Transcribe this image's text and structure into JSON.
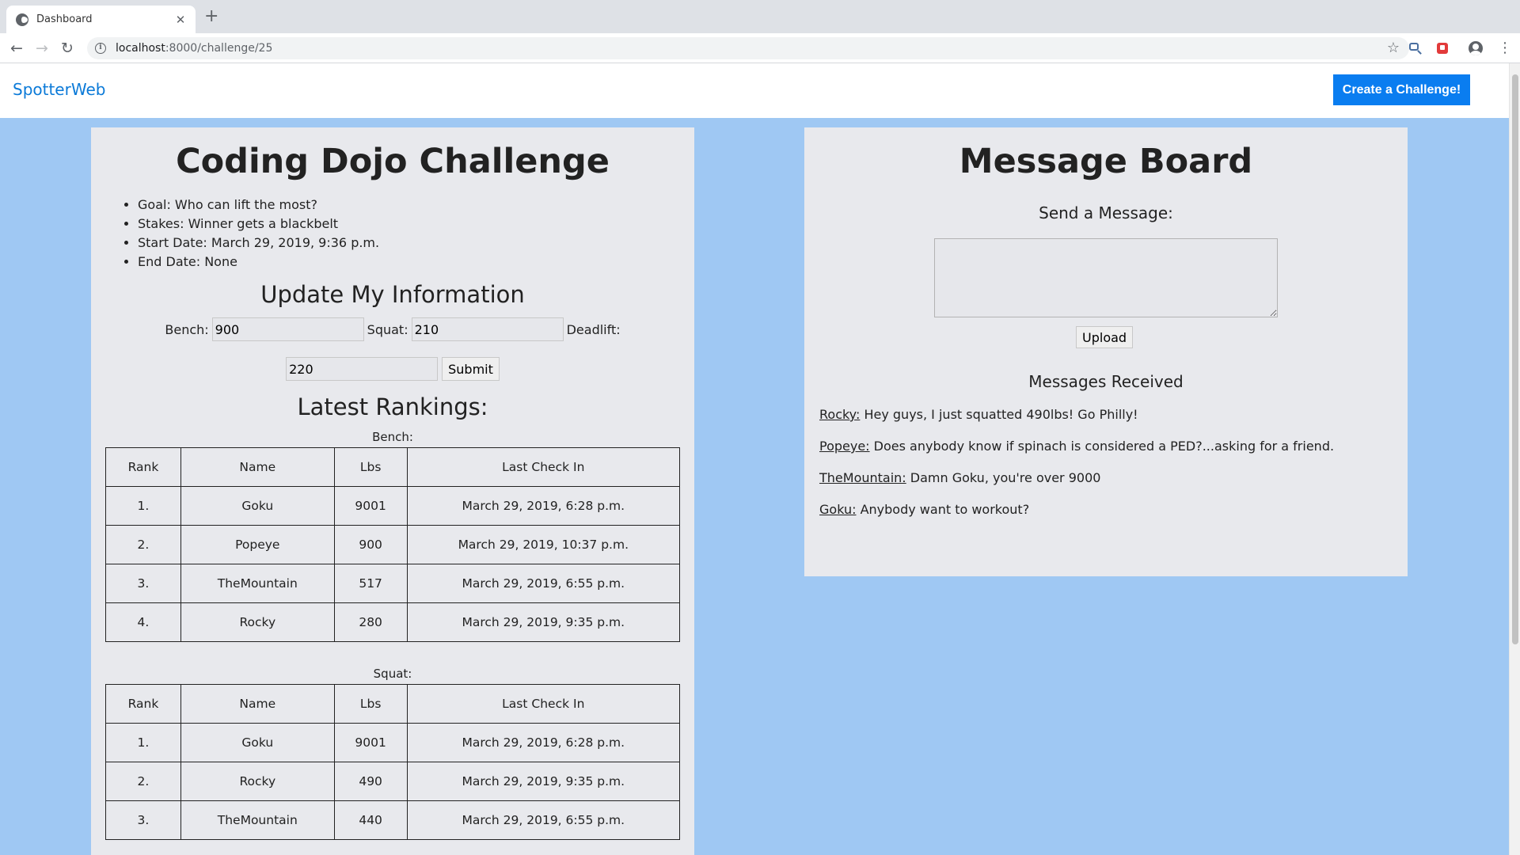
{
  "browser": {
    "tab_title": "Dashboard",
    "url_host": "localhost",
    "url_path": ":8000/challenge/25"
  },
  "nav": {
    "brand": "SpotterWeb",
    "create_button": "Create a Challenge!"
  },
  "challenge": {
    "title": "Coding Dojo Challenge",
    "details": [
      "Goal: Who can lift the most?",
      "Stakes: Winner gets a blackbelt",
      "Start Date: March 29, 2019, 9:36 p.m.",
      "End Date: None"
    ]
  },
  "update_form": {
    "title": "Update My Information",
    "bench_label": "Bench:",
    "bench_value": "900",
    "squat_label": "Squat:",
    "squat_value": "210",
    "deadlift_label": "Deadlift:",
    "deadlift_value": "220",
    "submit_label": "Submit"
  },
  "rankings": {
    "title": "Latest Rankings:",
    "columns": [
      "Rank",
      "Name",
      "Lbs",
      "Last Check In"
    ],
    "bench": {
      "caption": "Bench:",
      "rows": [
        [
          "1.",
          "Goku",
          "9001",
          "March 29, 2019, 6:28 p.m."
        ],
        [
          "2.",
          "Popeye",
          "900",
          "March 29, 2019, 10:37 p.m."
        ],
        [
          "3.",
          "TheMountain",
          "517",
          "March 29, 2019, 6:55 p.m."
        ],
        [
          "4.",
          "Rocky",
          "280",
          "March 29, 2019, 9:35 p.m."
        ]
      ]
    },
    "squat": {
      "caption": "Squat:",
      "rows": [
        [
          "1.",
          "Goku",
          "9001",
          "March 29, 2019, 6:28 p.m."
        ],
        [
          "2.",
          "Rocky",
          "490",
          "March 29, 2019, 9:35 p.m."
        ],
        [
          "3.",
          "TheMountain",
          "440",
          "March 29, 2019, 6:55 p.m."
        ]
      ]
    }
  },
  "message_board": {
    "title": "Message Board",
    "send_title": "Send a Message:",
    "upload_label": "Upload",
    "received_title": "Messages Received",
    "messages": [
      {
        "author": "Rocky:",
        "text": "Hey guys, I just squatted 490lbs! Go Philly!"
      },
      {
        "author": "Popeye:",
        "text": "Does anybody know if spinach is considered a PED?...asking for a friend."
      },
      {
        "author": "TheMountain:",
        "text": "Damn Goku, you're over 9000"
      },
      {
        "author": "Goku:",
        "text": "Anybody want to workout?"
      }
    ]
  }
}
